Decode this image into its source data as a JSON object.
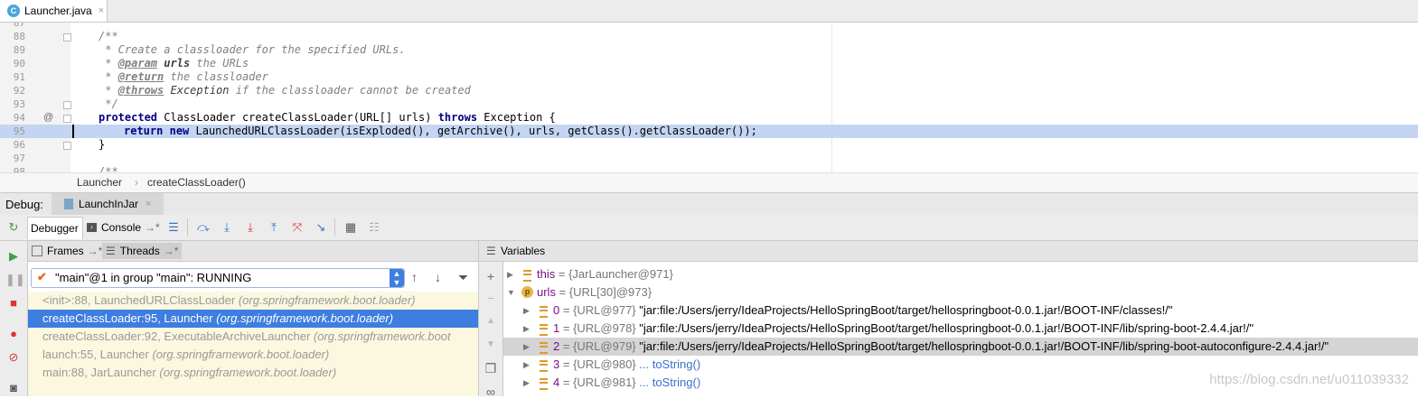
{
  "editor_tab": {
    "icon": "C",
    "filename": "Launcher.java",
    "close": "×"
  },
  "editor": {
    "top_partial_num": "87",
    "lines": [
      {
        "num": "88",
        "text": "/**"
      },
      {
        "num": "89",
        "text": " * Create a classloader for the specified URLs."
      },
      {
        "num": "90",
        "tag": "@param",
        "bold": "urls",
        "rest": " the URLs"
      },
      {
        "num": "91",
        "tag": "@return",
        "rest": " the classloader"
      },
      {
        "num": "92",
        "tag": "@throws",
        "bold": "Exception",
        "rest": " if the classloader cannot be created"
      },
      {
        "num": "93",
        "text": " */"
      },
      {
        "num": "94",
        "gutter_mark": "@",
        "kw1": "protected",
        "mid": " ClassLoader createClassLoader(URL[] urls) ",
        "kw2": "throws",
        "end": " Exception {"
      },
      {
        "num": "95",
        "kw1": "return",
        "kw2": "new",
        "end": " LaunchedURLClassLoader(isExploded(), getArchive(), urls, getClass().getClassLoader());"
      },
      {
        "num": "96",
        "text": "}"
      },
      {
        "num": "97",
        "text": ""
      },
      {
        "num": "98",
        "text": "/**"
      }
    ],
    "comment_prefix": " * "
  },
  "breadcrumb": {
    "class": "Launcher",
    "sep": "›",
    "method": "createClassLoader()"
  },
  "debug": {
    "title": "Debug:",
    "session_tab": "LaunchInJar",
    "session_close": "×",
    "tabs": {
      "debugger": "Debugger",
      "console": "Console",
      "console_suffix": "→*"
    }
  },
  "frames_panel": {
    "frames_tab": "Frames",
    "threads_tab": "Threads",
    "pin": "→*",
    "thread_selected": "\"main\"@1 in group \"main\": RUNNING",
    "frames": [
      {
        "method": "<init>:88, LaunchedURLClassLoader",
        "pkg": "(org.springframework.boot.loader)",
        "selected": false
      },
      {
        "method": "createClassLoader:95, Launcher",
        "pkg": "(org.springframework.boot.loader)",
        "selected": true
      },
      {
        "method": "createClassLoader:92, ExecutableArchiveLauncher",
        "pkg": "(org.springframework.boot",
        "selected": false
      },
      {
        "method": "launch:55, Launcher",
        "pkg": "(org.springframework.boot.loader)",
        "selected": false
      },
      {
        "method": "main:88, JarLauncher",
        "pkg": "(org.springframework.boot.loader)",
        "selected": false
      }
    ]
  },
  "variables_panel": {
    "title": "Variables",
    "rows": [
      {
        "indent": 0,
        "expanded": false,
        "icon": "field",
        "name": "this",
        "type": "= {JarLauncher@971}",
        "value": "",
        "selected": false
      },
      {
        "indent": 0,
        "expanded": true,
        "icon": "param",
        "name": "urls",
        "type": "= {URL[30]@973}",
        "value": "",
        "selected": false
      },
      {
        "indent": 1,
        "expanded": false,
        "icon": "field",
        "name": "0",
        "type": "= {URL@977}",
        "value": "\"jar:file:/Users/jerry/IdeaProjects/HelloSpringBoot/target/hellospringboot-0.0.1.jar!/BOOT-INF/classes!/\"",
        "selected": false
      },
      {
        "indent": 1,
        "expanded": false,
        "icon": "field",
        "name": "1",
        "type": "= {URL@978}",
        "value": "\"jar:file:/Users/jerry/IdeaProjects/HelloSpringBoot/target/hellospringboot-0.0.1.jar!/BOOT-INF/lib/spring-boot-2.4.4.jar!/\"",
        "selected": false
      },
      {
        "indent": 1,
        "expanded": false,
        "icon": "field",
        "name": "2",
        "type": "= {URL@979}",
        "value": "\"jar:file:/Users/jerry/IdeaProjects/HelloSpringBoot/target/hellospringboot-0.0.1.jar!/BOOT-INF/lib/spring-boot-autoconfigure-2.4.4.jar!/\"",
        "selected": true
      },
      {
        "indent": 1,
        "expanded": false,
        "icon": "field",
        "name": "3",
        "type": "= {URL@980}",
        "link": "... toString()",
        "selected": false
      },
      {
        "indent": 1,
        "expanded": false,
        "icon": "field",
        "name": "4",
        "type": "= {URL@981}",
        "link": "... toString()",
        "selected": false
      }
    ]
  },
  "watermark": "https://blog.csdn.net/u011039332",
  "colors": {
    "selection": "#3d7ee0",
    "highlight_line": "#c4d5f3",
    "frames_bg": "#fbf8df"
  }
}
